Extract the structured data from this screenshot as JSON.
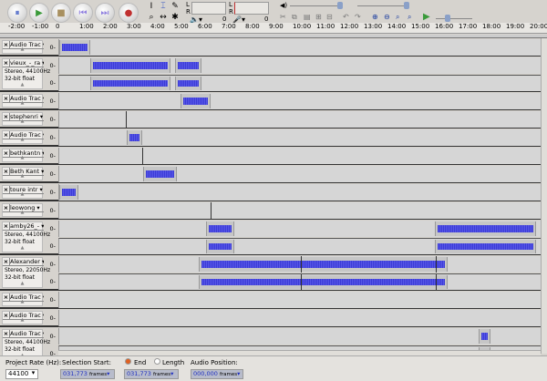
{
  "toolbar": {
    "pause": "⏸",
    "play": "▶",
    "stop": "■",
    "skip_start": "⏮",
    "skip_end": "⏭",
    "record": "●",
    "meter_left": "L",
    "meter_right": "R",
    "meter_zero": "0",
    "play_zero": "0"
  },
  "ruler": {
    "ticks": [
      "-2:00",
      "-1:00",
      "0",
      "1:00",
      "2:00",
      "3:00",
      "4:00",
      "5:00",
      "6:00",
      "7:00",
      "8:00",
      "9:00",
      "10:00",
      "11:00",
      "12:00",
      "13:00",
      "14:00",
      "15:00",
      "16:00",
      "17:00",
      "18:00",
      "19:00",
      "20:00"
    ]
  },
  "tracks": [
    {
      "name": "Audio Trac",
      "stereo": false,
      "clips": [
        [
          0,
          1.3
        ]
      ]
    },
    {
      "name": "vieux_-_ra",
      "stereo": true,
      "rate": "Stereo, 44100Hz",
      "format": "32-bit float",
      "clips": [
        [
          1.3,
          4.7
        ],
        [
          4.9,
          6.0
        ]
      ]
    },
    {
      "name": "Audio Trac",
      "stereo": false,
      "clips": [
        [
          5.1,
          6.4
        ]
      ]
    },
    {
      "name": "stephenri",
      "stereo": false,
      "clips": [],
      "lines": [
        2.8
      ]
    },
    {
      "name": "Audio Trac",
      "stereo": false,
      "clips": [
        [
          2.85,
          3.5
        ]
      ]
    },
    {
      "name": "bethkantn",
      "stereo": false,
      "clips": [],
      "lines": [
        3.5
      ]
    },
    {
      "name": "Beth Kant",
      "stereo": false,
      "clips": [
        [
          3.55,
          4.95
        ]
      ]
    },
    {
      "name": "toure intr",
      "stereo": false,
      "clips": [
        [
          0,
          0.8
        ]
      ]
    },
    {
      "name": "leowong",
      "stereo": false,
      "clips": [],
      "lines": [
        6.4
      ]
    },
    {
      "name": "amby26_-",
      "stereo": true,
      "rate": "Stereo, 44100Hz",
      "format": "32-bit float",
      "clips": [
        [
          6.2,
          7.4
        ],
        [
          15.85,
          20.1
        ]
      ]
    },
    {
      "name": "Alexander",
      "stereo": true,
      "rate": "Stereo, 22050Hz",
      "format": "32-bit float",
      "clips": [
        [
          5.9,
          16.4
        ]
      ],
      "lines": [
        10.2,
        15.9
      ]
    },
    {
      "name": "Audio Trac",
      "stereo": false,
      "clips": []
    },
    {
      "name": "Audio Trac",
      "stereo": false,
      "clips": []
    },
    {
      "name": "Audio Trac",
      "stereo": true,
      "rate": "Stereo, 44100Hz",
      "format": "32-bit float",
      "clips": [
        [
          17.7,
          18.2
        ]
      ]
    }
  ],
  "bottom": {
    "project_rate_label": "Project Rate (Hz):",
    "project_rate": "44100",
    "selection_start_label": "Selection Start:",
    "end_label": "End",
    "length_label": "Length",
    "audio_position_label": "Audio Position:",
    "selection_start": "031,773",
    "selection_end": "031,773",
    "audio_position": "000,000",
    "unit": "frames"
  },
  "colors": {
    "wave": "#3b3bd6",
    "record": "#c03030",
    "play": "#3a9a3a"
  }
}
